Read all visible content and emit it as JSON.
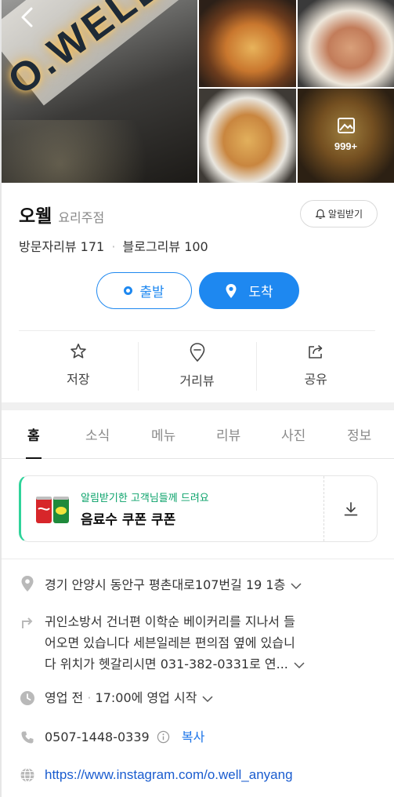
{
  "gallery": {
    "photo_count_label": "999+"
  },
  "place": {
    "name": "오웰",
    "category": "요리주점",
    "alarm_label": "알림받기",
    "visitor_reviews": "방문자리뷰 171",
    "blog_reviews": "블로그리뷰 100",
    "review_sep": "·"
  },
  "route": {
    "depart_label": "출발",
    "arrive_label": "도착"
  },
  "actions": [
    {
      "label": "저장",
      "icon": "star-icon"
    },
    {
      "label": "거리뷰",
      "icon": "street-view-icon"
    },
    {
      "label": "공유",
      "icon": "share-icon"
    }
  ],
  "tabs": [
    "홈",
    "소식",
    "메뉴",
    "리뷰",
    "사진",
    "정보"
  ],
  "active_tab": "홈",
  "coupon": {
    "subtitle": "알림받기한 고객님들께 드려요",
    "title": "음료수 쿠폰 쿠폰"
  },
  "info": {
    "address": "경기 안양시 동안구 평촌대로107번길 19 1층",
    "directions_line1": "귀인소방서 건너편 이학순 베이커리를 지나서 들",
    "directions_line2": "어오면 있습니다 세븐일레븐 편의점 옆에 있습니",
    "directions_line3": "다 위치가 헷갈리시면 031-382-0331로 연...",
    "hours_status": "영업 전",
    "hours_sep": "·",
    "hours_detail": "17:00에 영업 시작",
    "phone": "0507-1448-0339",
    "copy_label": "복사",
    "website": "https://www.instagram.com/o.well_anyang"
  },
  "colors": {
    "accent": "#1e88f0",
    "coupon_green": "#0aa26a"
  }
}
